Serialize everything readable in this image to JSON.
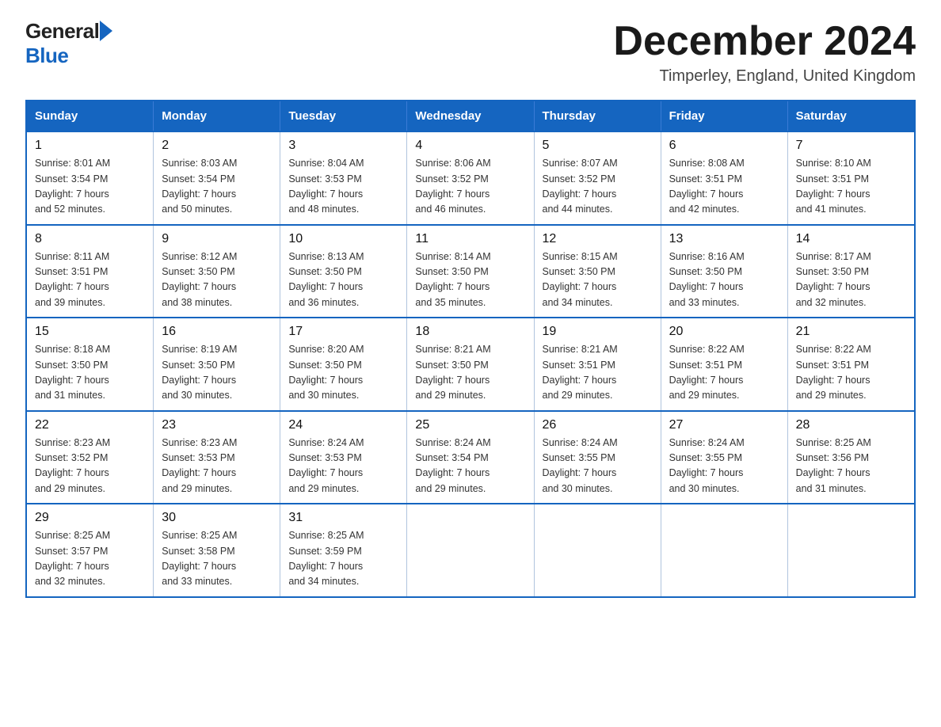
{
  "header": {
    "logo_general": "General",
    "logo_blue": "Blue",
    "title": "December 2024",
    "location": "Timperley, England, United Kingdom"
  },
  "days_of_week": [
    "Sunday",
    "Monday",
    "Tuesday",
    "Wednesday",
    "Thursday",
    "Friday",
    "Saturday"
  ],
  "weeks": [
    [
      {
        "day": "1",
        "sunrise": "8:01 AM",
        "sunset": "3:54 PM",
        "daylight": "7 hours and 52 minutes."
      },
      {
        "day": "2",
        "sunrise": "8:03 AM",
        "sunset": "3:54 PM",
        "daylight": "7 hours and 50 minutes."
      },
      {
        "day": "3",
        "sunrise": "8:04 AM",
        "sunset": "3:53 PM",
        "daylight": "7 hours and 48 minutes."
      },
      {
        "day": "4",
        "sunrise": "8:06 AM",
        "sunset": "3:52 PM",
        "daylight": "7 hours and 46 minutes."
      },
      {
        "day": "5",
        "sunrise": "8:07 AM",
        "sunset": "3:52 PM",
        "daylight": "7 hours and 44 minutes."
      },
      {
        "day": "6",
        "sunrise": "8:08 AM",
        "sunset": "3:51 PM",
        "daylight": "7 hours and 42 minutes."
      },
      {
        "day": "7",
        "sunrise": "8:10 AM",
        "sunset": "3:51 PM",
        "daylight": "7 hours and 41 minutes."
      }
    ],
    [
      {
        "day": "8",
        "sunrise": "8:11 AM",
        "sunset": "3:51 PM",
        "daylight": "7 hours and 39 minutes."
      },
      {
        "day": "9",
        "sunrise": "8:12 AM",
        "sunset": "3:50 PM",
        "daylight": "7 hours and 38 minutes."
      },
      {
        "day": "10",
        "sunrise": "8:13 AM",
        "sunset": "3:50 PM",
        "daylight": "7 hours and 36 minutes."
      },
      {
        "day": "11",
        "sunrise": "8:14 AM",
        "sunset": "3:50 PM",
        "daylight": "7 hours and 35 minutes."
      },
      {
        "day": "12",
        "sunrise": "8:15 AM",
        "sunset": "3:50 PM",
        "daylight": "7 hours and 34 minutes."
      },
      {
        "day": "13",
        "sunrise": "8:16 AM",
        "sunset": "3:50 PM",
        "daylight": "7 hours and 33 minutes."
      },
      {
        "day": "14",
        "sunrise": "8:17 AM",
        "sunset": "3:50 PM",
        "daylight": "7 hours and 32 minutes."
      }
    ],
    [
      {
        "day": "15",
        "sunrise": "8:18 AM",
        "sunset": "3:50 PM",
        "daylight": "7 hours and 31 minutes."
      },
      {
        "day": "16",
        "sunrise": "8:19 AM",
        "sunset": "3:50 PM",
        "daylight": "7 hours and 30 minutes."
      },
      {
        "day": "17",
        "sunrise": "8:20 AM",
        "sunset": "3:50 PM",
        "daylight": "7 hours and 30 minutes."
      },
      {
        "day": "18",
        "sunrise": "8:21 AM",
        "sunset": "3:50 PM",
        "daylight": "7 hours and 29 minutes."
      },
      {
        "day": "19",
        "sunrise": "8:21 AM",
        "sunset": "3:51 PM",
        "daylight": "7 hours and 29 minutes."
      },
      {
        "day": "20",
        "sunrise": "8:22 AM",
        "sunset": "3:51 PM",
        "daylight": "7 hours and 29 minutes."
      },
      {
        "day": "21",
        "sunrise": "8:22 AM",
        "sunset": "3:51 PM",
        "daylight": "7 hours and 29 minutes."
      }
    ],
    [
      {
        "day": "22",
        "sunrise": "8:23 AM",
        "sunset": "3:52 PM",
        "daylight": "7 hours and 29 minutes."
      },
      {
        "day": "23",
        "sunrise": "8:23 AM",
        "sunset": "3:53 PM",
        "daylight": "7 hours and 29 minutes."
      },
      {
        "day": "24",
        "sunrise": "8:24 AM",
        "sunset": "3:53 PM",
        "daylight": "7 hours and 29 minutes."
      },
      {
        "day": "25",
        "sunrise": "8:24 AM",
        "sunset": "3:54 PM",
        "daylight": "7 hours and 29 minutes."
      },
      {
        "day": "26",
        "sunrise": "8:24 AM",
        "sunset": "3:55 PM",
        "daylight": "7 hours and 30 minutes."
      },
      {
        "day": "27",
        "sunrise": "8:24 AM",
        "sunset": "3:55 PM",
        "daylight": "7 hours and 30 minutes."
      },
      {
        "day": "28",
        "sunrise": "8:25 AM",
        "sunset": "3:56 PM",
        "daylight": "7 hours and 31 minutes."
      }
    ],
    [
      {
        "day": "29",
        "sunrise": "8:25 AM",
        "sunset": "3:57 PM",
        "daylight": "7 hours and 32 minutes."
      },
      {
        "day": "30",
        "sunrise": "8:25 AM",
        "sunset": "3:58 PM",
        "daylight": "7 hours and 33 minutes."
      },
      {
        "day": "31",
        "sunrise": "8:25 AM",
        "sunset": "3:59 PM",
        "daylight": "7 hours and 34 minutes."
      },
      null,
      null,
      null,
      null
    ]
  ],
  "labels": {
    "sunrise": "Sunrise: ",
    "sunset": "Sunset: ",
    "daylight": "Daylight: "
  }
}
